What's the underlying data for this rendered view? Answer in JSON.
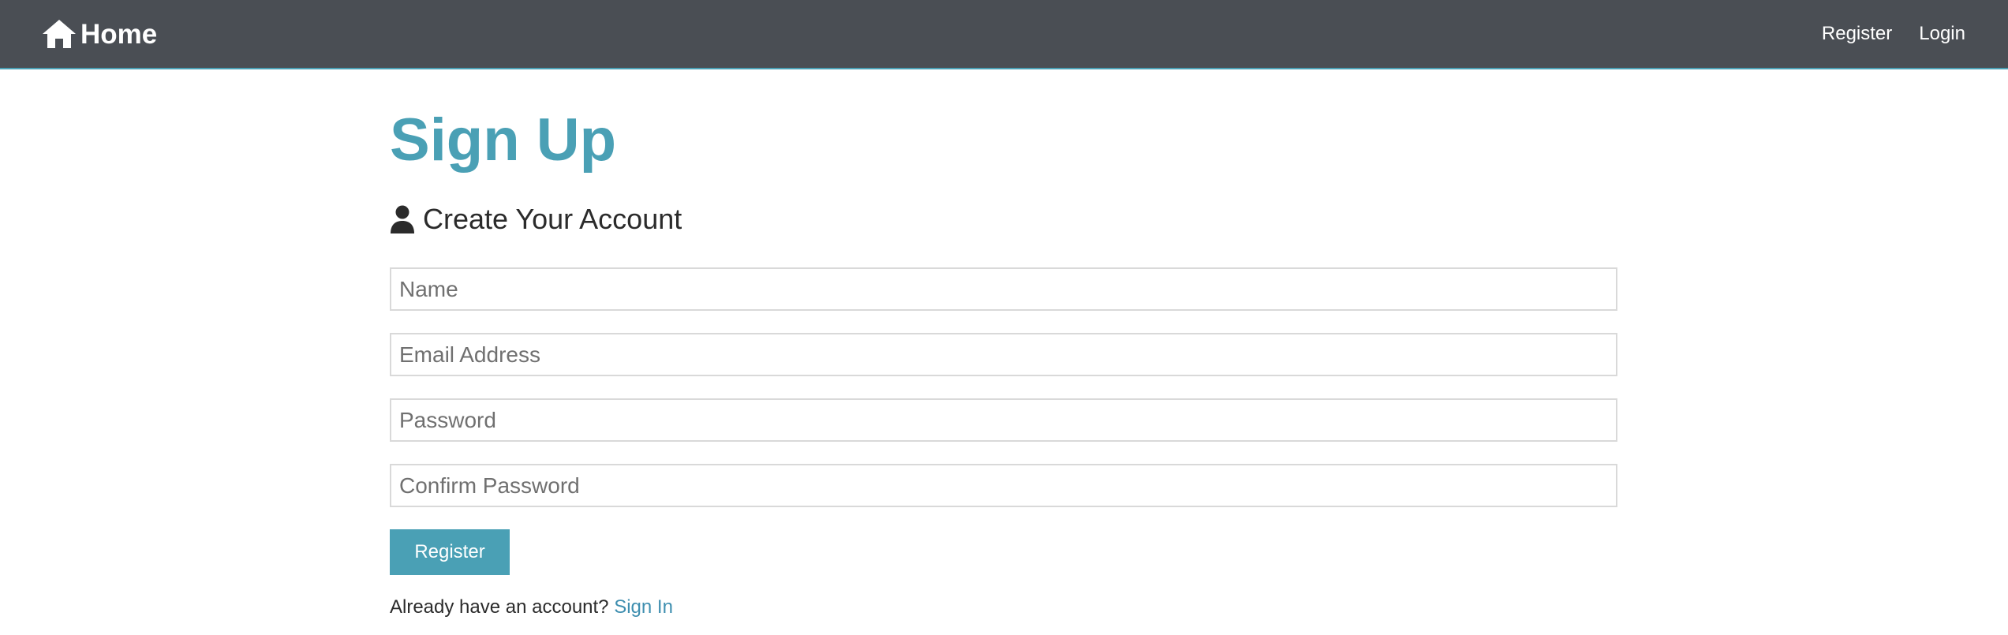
{
  "navbar": {
    "brand_label": "Home",
    "brand_icon": "home-icon",
    "links": [
      {
        "label": "Register"
      },
      {
        "label": "Login"
      }
    ]
  },
  "page": {
    "title": "Sign Up",
    "subtitle": "Create Your Account",
    "subtitle_icon": "user-icon"
  },
  "form": {
    "name_placeholder": "Name",
    "email_placeholder": "Email Address",
    "password_placeholder": "Password",
    "confirm_placeholder": "Confirm Password",
    "submit_label": "Register"
  },
  "footer": {
    "prompt": "Already have an account?",
    "link_label": "Sign In"
  },
  "colors": {
    "navbar_bg": "#4a4e54",
    "accent": "#4aa0b5",
    "link": "#3f8fb0"
  }
}
